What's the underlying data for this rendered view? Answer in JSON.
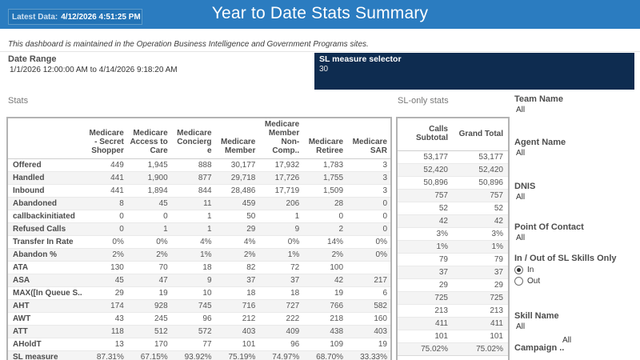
{
  "header": {
    "latest_data_label": "Latest Data:",
    "latest_data_value": "4/12/2026 4:51:25 PM",
    "title": "Year to Date Stats Summary"
  },
  "notice": "This dashboard is maintained in the Operation Business Intelligence and Government Programs sites.",
  "date_range": {
    "label": "Date Range",
    "value": "1/1/2026 12:00:00 AM to 4/14/2026 9:18:20 AM"
  },
  "sl_measure_selector": {
    "label": "SL measure selector",
    "value": "30"
  },
  "stats": {
    "section_label": "Stats",
    "columns": [
      "Medicare - Secret Shopper",
      "Medicare Access to Care",
      "Medicare Concierge",
      "Medicare Member",
      "Medicare Member Non-Comp..",
      "Medicare Retiree",
      "Medicare SAR"
    ],
    "rows": [
      {
        "label": "Offered",
        "values": [
          "449",
          "1,945",
          "888",
          "30,177",
          "17,932",
          "1,783",
          "3"
        ]
      },
      {
        "label": "Handled",
        "values": [
          "441",
          "1,900",
          "877",
          "29,718",
          "17,726",
          "1,755",
          "3"
        ]
      },
      {
        "label": "Inbound",
        "values": [
          "441",
          "1,894",
          "844",
          "28,486",
          "17,719",
          "1,509",
          "3"
        ]
      },
      {
        "label": "Abandoned",
        "values": [
          "8",
          "45",
          "11",
          "459",
          "206",
          "28",
          "0"
        ]
      },
      {
        "label": "callbackinitiated",
        "values": [
          "0",
          "0",
          "1",
          "50",
          "1",
          "0",
          "0"
        ]
      },
      {
        "label": "Refused Calls",
        "values": [
          "0",
          "1",
          "1",
          "29",
          "9",
          "2",
          "0"
        ]
      },
      {
        "label": "Transfer In Rate",
        "values": [
          "0%",
          "0%",
          "4%",
          "4%",
          "0%",
          "14%",
          "0%"
        ]
      },
      {
        "label": "Abandon %",
        "values": [
          "2%",
          "2%",
          "1%",
          "2%",
          "1%",
          "2%",
          "0%"
        ]
      },
      {
        "label": "ATA",
        "values": [
          "130",
          "70",
          "18",
          "82",
          "72",
          "100",
          ""
        ]
      },
      {
        "label": "ASA",
        "values": [
          "45",
          "47",
          "9",
          "37",
          "37",
          "42",
          "217"
        ]
      },
      {
        "label": "MAX([In Queue S..",
        "values": [
          "29",
          "19",
          "10",
          "18",
          "18",
          "19",
          "6"
        ]
      },
      {
        "label": "AHT",
        "values": [
          "174",
          "928",
          "745",
          "716",
          "727",
          "766",
          "582"
        ]
      },
      {
        "label": "AWT",
        "values": [
          "43",
          "245",
          "96",
          "212",
          "222",
          "218",
          "160"
        ]
      },
      {
        "label": "ATT",
        "values": [
          "118",
          "512",
          "572",
          "403",
          "409",
          "438",
          "403"
        ]
      },
      {
        "label": "AHoldT",
        "values": [
          "13",
          "170",
          "77",
          "101",
          "96",
          "109",
          "19"
        ]
      },
      {
        "label": "SL measure",
        "values": [
          "87.31%",
          "67.15%",
          "93.92%",
          "75.19%",
          "74.97%",
          "68.70%",
          "33.33%"
        ]
      }
    ]
  },
  "sl_only": {
    "section_label": "SL-only stats",
    "columns": [
      "Calls Subtotal",
      "Grand Total"
    ],
    "rows": [
      [
        "53,177",
        "53,177"
      ],
      [
        "52,420",
        "52,420"
      ],
      [
        "50,896",
        "50,896"
      ],
      [
        "757",
        "757"
      ],
      [
        "52",
        "52"
      ],
      [
        "42",
        "42"
      ],
      [
        "3%",
        "3%"
      ],
      [
        "1%",
        "1%"
      ],
      [
        "79",
        "79"
      ],
      [
        "37",
        "37"
      ],
      [
        "29",
        "29"
      ],
      [
        "725",
        "725"
      ],
      [
        "213",
        "213"
      ],
      [
        "411",
        "411"
      ],
      [
        "101",
        "101"
      ],
      [
        "75.02%",
        "75.02%"
      ]
    ]
  },
  "filters": {
    "team_name": {
      "label": "Team Name",
      "value": "All"
    },
    "agent_name": {
      "label": "Agent Name",
      "value": "All"
    },
    "dnis": {
      "label": "DNIS",
      "value": "All"
    },
    "point_of_contact": {
      "label": "Point Of Contact",
      "value": "All"
    },
    "sl_skills": {
      "label": "In / Out of SL Skills Only",
      "options": [
        {
          "label": "In",
          "selected": true
        },
        {
          "label": "Out",
          "selected": false
        }
      ]
    },
    "skill_name": {
      "label": "Skill Name",
      "value": "All"
    },
    "campaign": {
      "label": "Campaign ..",
      "value": "All"
    }
  },
  "colors": {
    "header_bar": "#2b7cc0",
    "latest_data_box": "#2273b6",
    "selector_bg": "#0e2c50",
    "row_banding": "#f4f4f4"
  }
}
